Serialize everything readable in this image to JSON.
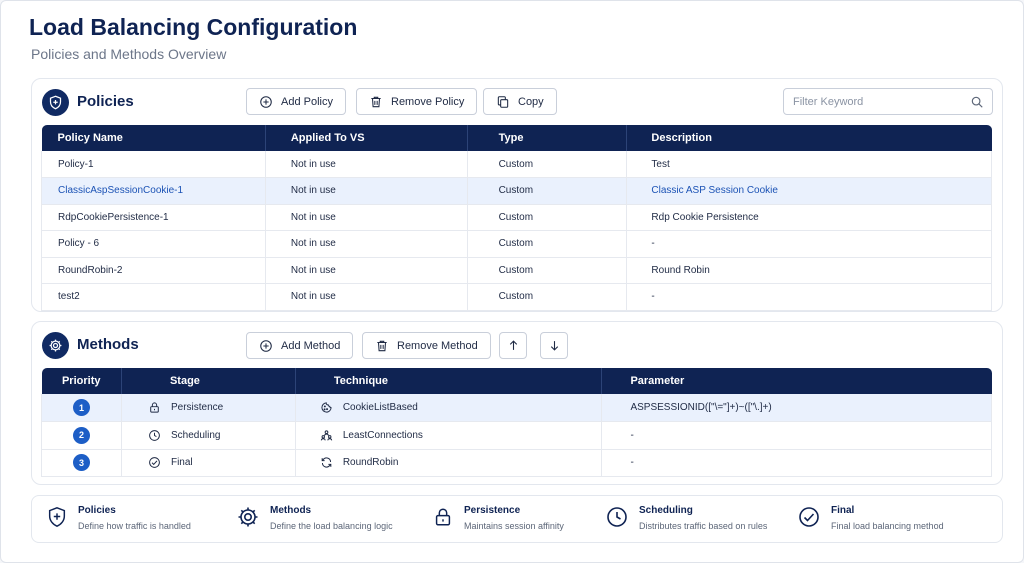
{
  "header": {
    "title": "Load Balancing Configuration",
    "subtitle": "Policies and Methods Overview"
  },
  "policies": {
    "title": "Policies",
    "add_label": "Add Policy",
    "remove_label": "Remove Policy",
    "copy_label": "Copy",
    "filter_placeholder": "Filter Keyword",
    "columns": [
      "Policy Name",
      "Applied To VS",
      "Type",
      "Description"
    ],
    "rows": [
      {
        "name": "Policy-1",
        "applied": "Not in use",
        "type": "Custom",
        "description": "Test"
      },
      {
        "name": "ClassicAspSessionCookie-1",
        "applied": "Not in use",
        "type": "Custom",
        "description": "Classic ASP Session Cookie"
      },
      {
        "name": "RdpCookiePersistence-1",
        "applied": "Not in use",
        "type": "Custom",
        "description": "Rdp Cookie Persistence"
      },
      {
        "name": "Policy - 6",
        "applied": "Not in use",
        "type": "Custom",
        "description": "-"
      },
      {
        "name": "RoundRobin-2",
        "applied": "Not in use",
        "type": "Custom",
        "description": "Round Robin"
      },
      {
        "name": "test2",
        "applied": "Not in use",
        "type": "Custom",
        "description": "-"
      }
    ]
  },
  "methods": {
    "title": "Methods",
    "add_label": "Add Method",
    "remove_label": "Remove Method",
    "columns": [
      "Priority",
      "Stage",
      "Technique",
      "Parameter"
    ],
    "rows": [
      {
        "priority": "1",
        "stage": "Persistence",
        "stage_icon": "lock-icon",
        "technique": "CookieListBased",
        "technique_icon": "cookie-icon",
        "parameter": "ASPSESSIONID([\"\\=\"]+)~([\"\\.]+)"
      },
      {
        "priority": "2",
        "stage": "Scheduling",
        "stage_icon": "clock-icon",
        "technique": "LeastConnections",
        "technique_icon": "users-icon",
        "parameter": "-"
      },
      {
        "priority": "3",
        "stage": "Final",
        "stage_icon": "check-circle-icon",
        "technique": "RoundRobin",
        "technique_icon": "refresh-icon",
        "parameter": "-"
      }
    ]
  },
  "legend": [
    {
      "title": "Policies",
      "desc": "Define how traffic is handled",
      "icon": "shield-icon"
    },
    {
      "title": "Methods",
      "desc": "Define the load balancing logic",
      "icon": "gear-icon"
    },
    {
      "title": "Persistence",
      "desc": "Maintains session affinity",
      "icon": "lock-icon"
    },
    {
      "title": "Scheduling",
      "desc": "Distributes traffic based on rules",
      "icon": "clock-icon"
    },
    {
      "title": "Final",
      "desc": "Final load balancing method",
      "icon": "check-circle-icon"
    }
  ],
  "colors": {
    "navy": "#0f2353",
    "accent_blue": "#1d5ec6",
    "selected_row": "#eaf1fd"
  }
}
